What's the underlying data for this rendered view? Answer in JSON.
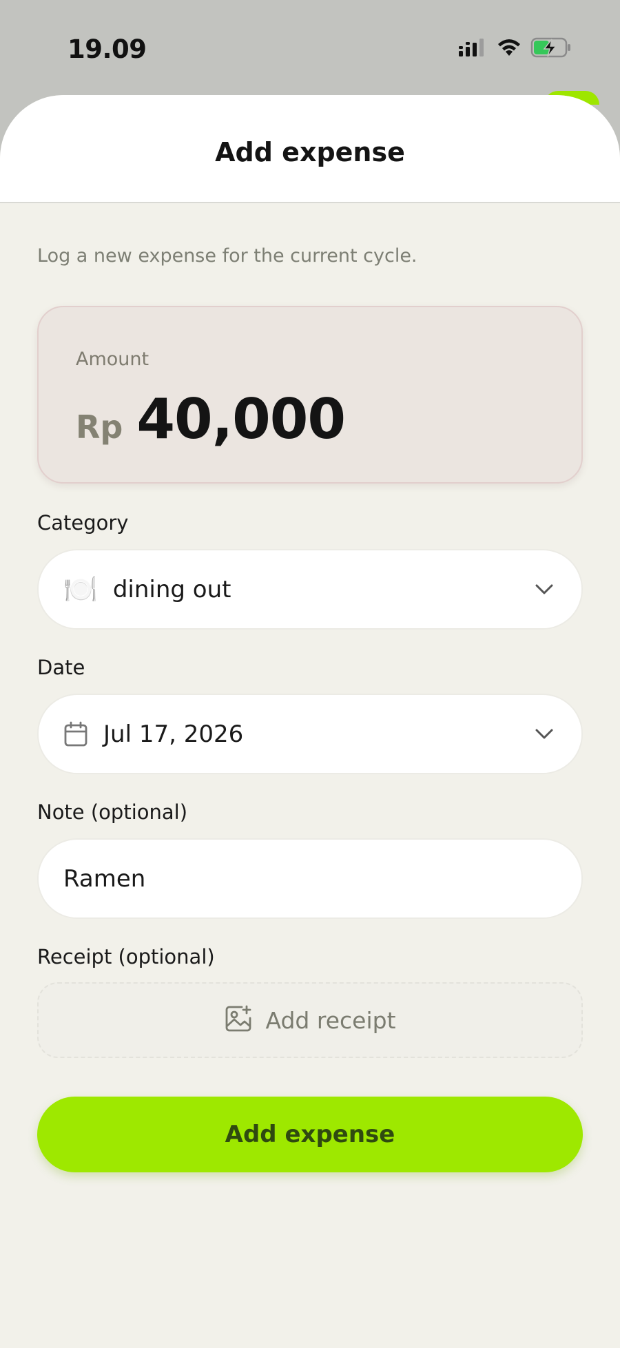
{
  "status_bar": {
    "time": "19.09",
    "icons": [
      "signal-icon",
      "wifi-icon",
      "battery-charging-icon"
    ]
  },
  "sheet": {
    "title": "Add expense",
    "subtitle": "Log a new expense for the current cycle."
  },
  "amount": {
    "label": "Amount",
    "currency": "Rp",
    "value": "40,000"
  },
  "category": {
    "label": "Category",
    "icon": "🍽️",
    "value": "dining out"
  },
  "date": {
    "label": "Date",
    "value": "Jul 17, 2026"
  },
  "note": {
    "label": "Note (optional)",
    "value": "Ramen"
  },
  "receipt": {
    "label": "Receipt (optional)",
    "button_label": "Add receipt"
  },
  "submit": {
    "label": "Add expense"
  },
  "colors": {
    "accent": "#9ee800",
    "background": "#f2f1ea",
    "amount_card": "#ebe5e0"
  }
}
